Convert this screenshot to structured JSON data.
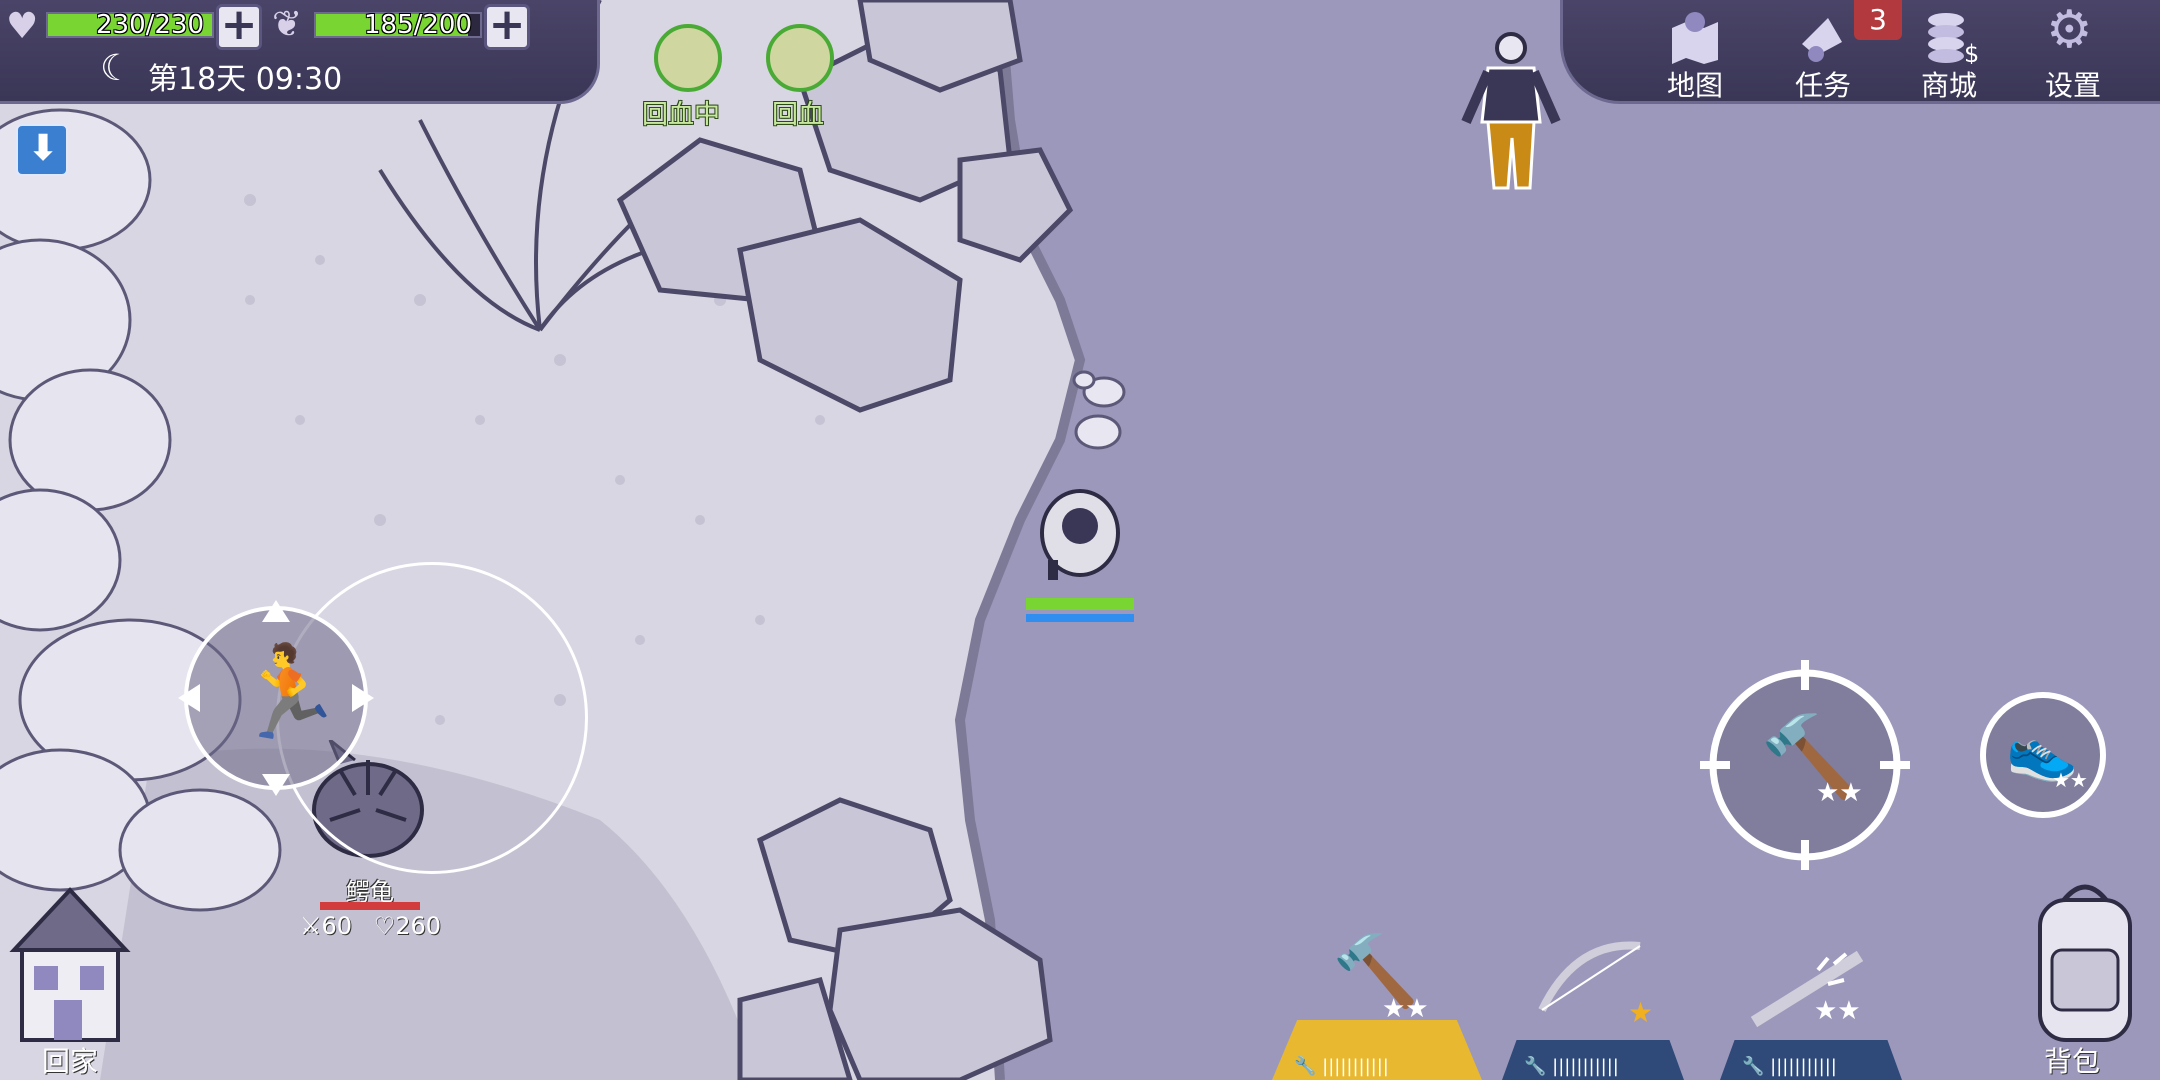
{
  "hud": {
    "health": {
      "current": 230,
      "max": 230,
      "text": "230/230"
    },
    "hunger": {
      "current": 185,
      "max": 200,
      "text": "185/200"
    },
    "day_time": "第18天 09:30"
  },
  "status_effects": [
    {
      "label": "回血中",
      "icon": "muscle-icon"
    },
    {
      "label": "回血",
      "icon": "bandage-icon"
    }
  ],
  "menu": [
    {
      "label": "地图",
      "icon": "map-icon"
    },
    {
      "label": "任务",
      "icon": "quest-horn-icon",
      "badge": "3"
    },
    {
      "label": "商城",
      "icon": "coins-icon"
    },
    {
      "label": "设置",
      "icon": "gear-icon"
    }
  ],
  "enemy": {
    "name": "鳄龟",
    "attack": "60",
    "health": "260",
    "hp_fraction": 1.0
  },
  "player": {
    "hp_fraction": 1.0,
    "stamina_fraction": 1.0
  },
  "skills": [
    {
      "icon": "hammer-icon",
      "stars": "★★"
    },
    {
      "icon": "sprint-shoes-icon",
      "stars": "★★"
    }
  ],
  "hotbar": [
    {
      "icon": "stone-hammer-icon",
      "stars": "★★",
      "selected": true
    },
    {
      "icon": "bow-icon",
      "stars": "★",
      "selected": false
    },
    {
      "icon": "spiked-club-icon",
      "stars": "★★",
      "selected": false
    }
  ],
  "bottom": {
    "home_label": "回家",
    "backpack_label": "背包"
  },
  "colors": {
    "hp_green": "#79d632",
    "stamina_blue": "#2f8ef0",
    "enemy_red": "#d23c3c",
    "hotbar_selected": "#e8b830",
    "hotbar_default": "#2f4a78"
  }
}
